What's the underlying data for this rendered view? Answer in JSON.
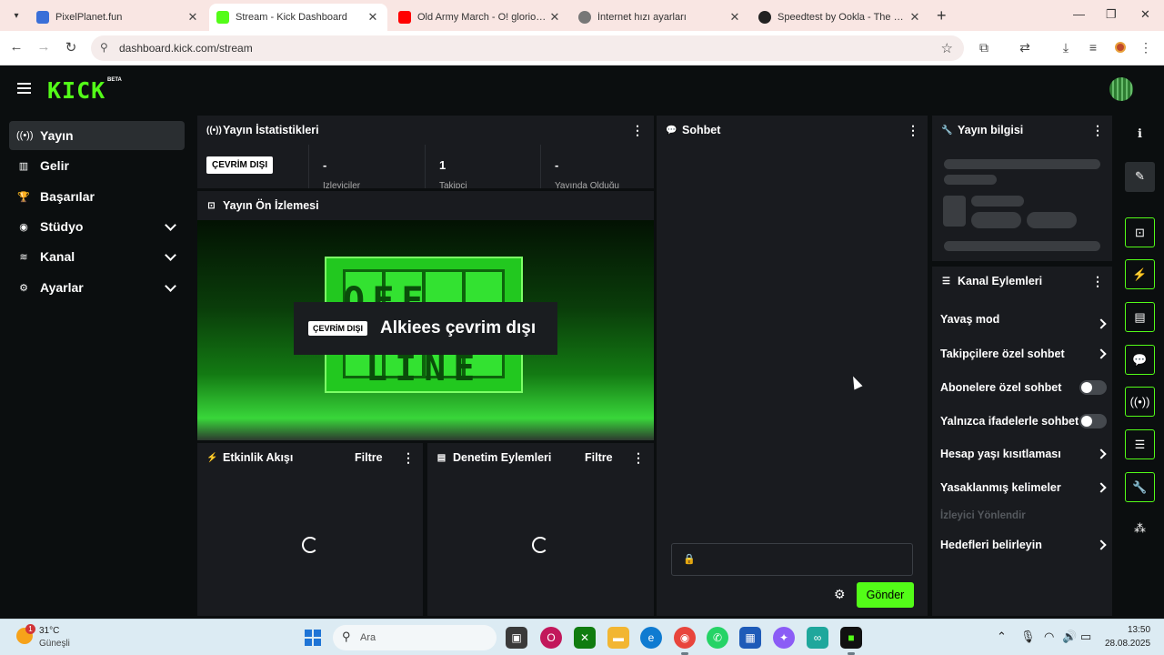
{
  "browser": {
    "tabs": [
      {
        "title": "PixelPlanet.fun",
        "favicon_color": "#3a6fd8"
      },
      {
        "title": "Stream - Kick Dashboard",
        "favicon_color": "#53fc18"
      },
      {
        "title": "Old Army March - O! glorious a",
        "favicon_color": "#ff0000"
      },
      {
        "title": "İnternet hızı ayarları",
        "favicon_color": "#777777"
      },
      {
        "title": "Speedtest by Ookla - The Globa",
        "favicon_color": "#222222"
      }
    ],
    "close_glyph": "✕",
    "new_tab_glyph": "+",
    "minimize_glyph": "—",
    "maximize_glyph": "❐",
    "window_close_glyph": "✕",
    "url": "dashboard.kick.com/stream"
  },
  "header": {
    "logo": "KICK",
    "beta": "BETA"
  },
  "sidebar": {
    "items": [
      {
        "label": "Yayın",
        "icon": "broadcast-icon",
        "glyph": "((•))"
      },
      {
        "label": "Gelir",
        "icon": "chart-icon",
        "glyph": "▥"
      },
      {
        "label": "Başarılar",
        "icon": "trophy-icon",
        "glyph": "🏆"
      },
      {
        "label": "Stüdyo",
        "icon": "studio-icon",
        "glyph": "◉"
      },
      {
        "label": "Kanal",
        "icon": "channel-icon",
        "glyph": "≋"
      },
      {
        "label": "Ayarlar",
        "icon": "gear-icon",
        "glyph": "⚙"
      }
    ]
  },
  "stats": {
    "title": "Yayın İstatistikleri",
    "status": "ÇEVRİM DIŞI",
    "cells": [
      {
        "value": "-",
        "label": "İzleyiciler"
      },
      {
        "value": "1",
        "label": "Takipçi"
      },
      {
        "value": "-",
        "label": "Yayında Olduğu"
      }
    ]
  },
  "preview": {
    "title": "Yayın Ön İzlemesi",
    "badge": "ÇEVRİM DIŞI",
    "message": "Alkiees çevrim dışı",
    "screen_top": "OFF",
    "screen_bottom": "LINE"
  },
  "events": {
    "title": "Etkinlik Akışı",
    "filter": "Filtre"
  },
  "moderation": {
    "title": "Denetim Eylemleri",
    "filter": "Filtre"
  },
  "chat": {
    "title": "Sohbet",
    "send": "Gönder"
  },
  "stream_info": {
    "title": "Yayın bilgisi"
  },
  "channel_actions": {
    "title": "Kanal Eylemleri",
    "items": [
      {
        "label": "Yavaş mod",
        "control": "arrow"
      },
      {
        "label": "Takipçilere özel sohbet",
        "control": "arrow"
      },
      {
        "label": "Abonelere özel sohbet",
        "control": "toggle",
        "on": false
      },
      {
        "label": "Yalnızca ifadelerle sohbet",
        "control": "toggle",
        "on": false
      },
      {
        "label": "Hesap yaşı kısıtlaması",
        "control": "arrow"
      },
      {
        "label": "Yasaklanmış kelimeler",
        "control": "arrow"
      }
    ],
    "section": "İzleyici Yönlendir",
    "goal": "Hedefleri belirleyin"
  },
  "taskbar": {
    "weather_temp": "31°C",
    "weather_cond": "Güneşli",
    "badge": "1",
    "search": "Ara",
    "time": "13:50",
    "date": "28.08.2025"
  },
  "colors": {
    "accent": "#53fc18",
    "panel": "#191b1f",
    "background": "#0b0e0f"
  }
}
